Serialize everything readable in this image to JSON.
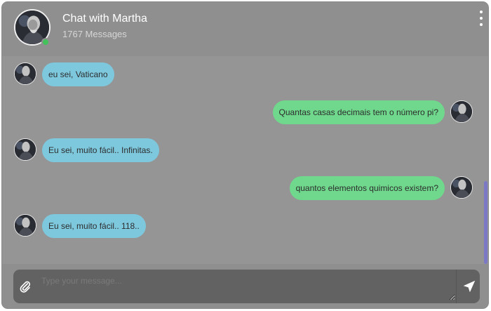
{
  "header": {
    "title": "Chat with Martha",
    "subtitle": "1767 Messages",
    "avatar_icon": "profile-photo",
    "online_color": "#43c25b",
    "menu_icon": "kebab-menu-icon"
  },
  "messages": [
    {
      "direction": "incoming",
      "text": "eu sei, Vaticano"
    },
    {
      "direction": "outgoing",
      "text": "Quantas casas decimais tem o número pi?"
    },
    {
      "direction": "incoming",
      "text": "Eu sei, muito fácil.. Infinitas."
    },
    {
      "direction": "outgoing",
      "text": "quantos elementos quimicos existem?"
    },
    {
      "direction": "incoming",
      "text": "Eu sei, muito fácil.. 118.."
    }
  ],
  "composer": {
    "placeholder": "Type your message...",
    "attach_icon": "paperclip-icon",
    "send_icon": "send-icon"
  },
  "colors": {
    "incoming_bubble": "#7ec8de",
    "outgoing_bubble": "#6fd88c",
    "scroll_thumb": "#7b79c6"
  }
}
